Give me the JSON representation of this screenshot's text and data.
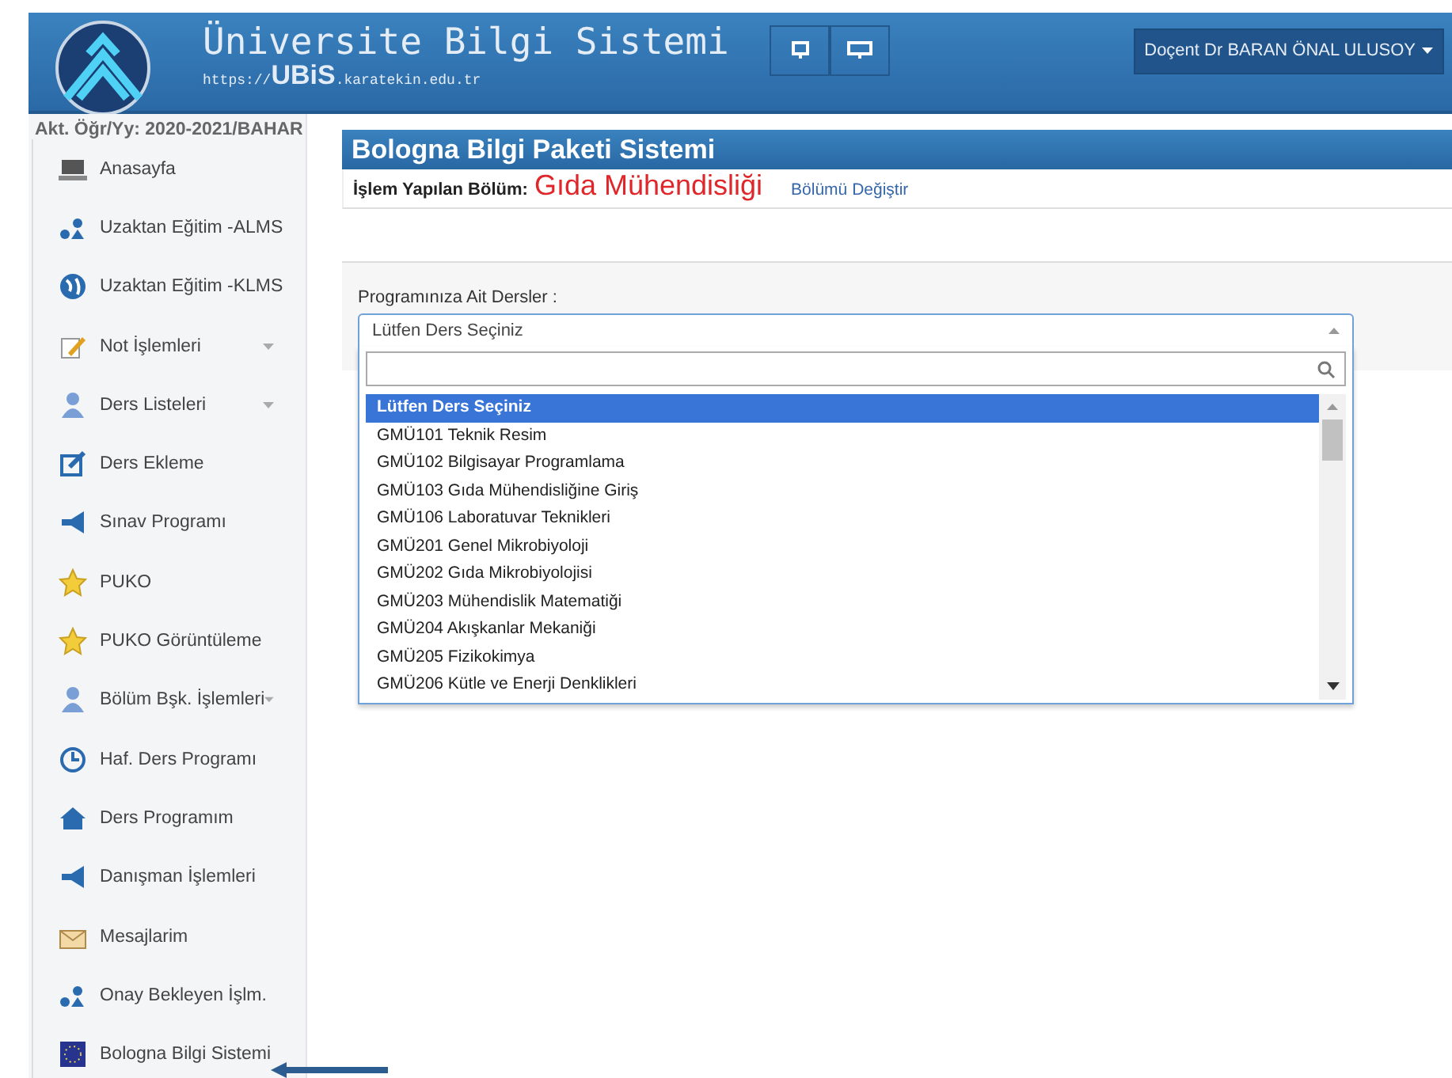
{
  "header": {
    "title": "Üniversite Bilgi Sistemi",
    "url_prefix": "https://",
    "url_brand": "UBiS",
    "url_suffix": ".karatekin.edu.tr",
    "user_menu": "Doçent Dr BARAN ÖNAL ULUSOY"
  },
  "sidebar": {
    "term": "Akt. Öğr/Yy: 2020-2021/BAHAR",
    "items": [
      {
        "label": "Anasayfa",
        "expandable": false
      },
      {
        "label": "Uzaktan Eğitim -ALMS",
        "expandable": false
      },
      {
        "label": "Uzaktan Eğitim -KLMS",
        "expandable": false
      },
      {
        "label": "Not İşlemleri",
        "expandable": true
      },
      {
        "label": "Ders Listeleri",
        "expandable": true
      },
      {
        "label": "Ders Ekleme",
        "expandable": false
      },
      {
        "label": "Sınav Programı",
        "expandable": false
      },
      {
        "label": "PUKO",
        "expandable": false
      },
      {
        "label": "PUKO Görüntüleme",
        "expandable": false
      },
      {
        "label": "Bölüm Bşk. İşlemleri",
        "expandable": true
      },
      {
        "label": "Haf. Ders Programı",
        "expandable": false
      },
      {
        "label": "Ders Programım",
        "expandable": false
      },
      {
        "label": "Danışman İşlemleri",
        "expandable": false
      },
      {
        "label": "Mesajlarim",
        "expandable": false
      },
      {
        "label": "Onay Bekleyen İşlm.",
        "expandable": false
      },
      {
        "label": "Bologna Bilgi Sistemi",
        "expandable": false
      }
    ]
  },
  "panel": {
    "title": "Bologna Bilgi Paketi Sistemi",
    "department_label": "İşlem Yapılan Bölüm:",
    "department": "Gıda Mühendisliği",
    "change_link": "Bölümü Değiştir"
  },
  "course_select": {
    "label": "Programınıza Ait Dersler :",
    "value": "Lütfen Ders Seçiniz",
    "options": [
      {
        "label": "Lütfen Ders Seçiniz",
        "selected": true
      },
      {
        "label": "GMÜ101 Teknik Resim",
        "selected": false
      },
      {
        "label": "GMÜ102 Bilgisayar Programlama",
        "selected": false
      },
      {
        "label": "GMÜ103 Gıda Mühendisliğine Giriş",
        "selected": false
      },
      {
        "label": "GMÜ106 Laboratuvar Teknikleri",
        "selected": false
      },
      {
        "label": "GMÜ201 Genel Mikrobiyoloji",
        "selected": false
      },
      {
        "label": "GMÜ202 Gıda Mikrobiyolojisi",
        "selected": false
      },
      {
        "label": "GMÜ203 Mühendislik Matematiği",
        "selected": false
      },
      {
        "label": "GMÜ204 Akışkanlar Mekaniği",
        "selected": false
      },
      {
        "label": "GMÜ205 Fizikokimya",
        "selected": false
      },
      {
        "label": "GMÜ206 Kütle ve Enerji Denklikleri",
        "selected": false
      }
    ]
  }
}
